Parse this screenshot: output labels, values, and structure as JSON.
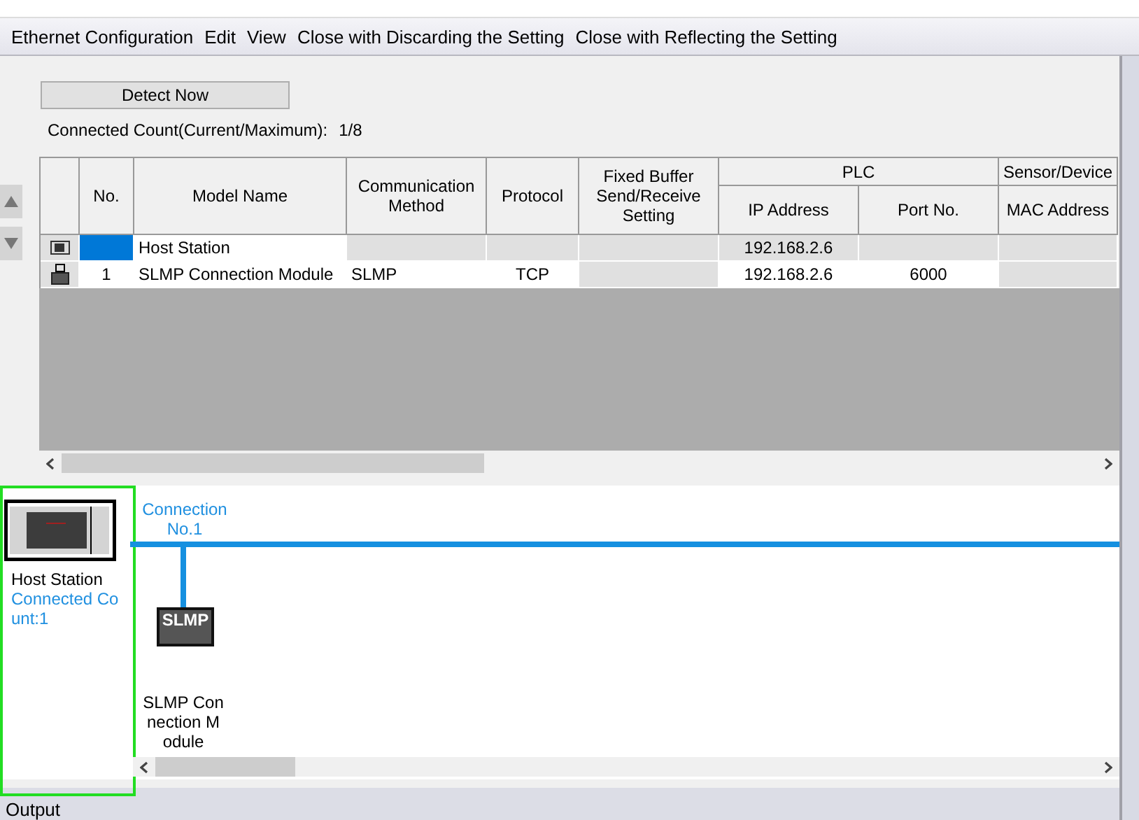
{
  "menu": [
    {
      "label": "Ethernet Configuration"
    },
    {
      "label": "Edit"
    },
    {
      "label": "View"
    },
    {
      "label": "Close with Discarding the Setting"
    },
    {
      "label": "Close with Reflecting the Setting"
    }
  ],
  "detect_button": "Detect Now",
  "connected_count": {
    "label": "Connected Count(Current/Maximum):",
    "value": "1/8"
  },
  "table": {
    "columns": [
      "No.",
      "Model Name",
      "Communication Method",
      "Protocol",
      "Fixed Buffer Send/Receive Setting"
    ],
    "groups": [
      {
        "label": "PLC",
        "columns": [
          "IP Address",
          "Port No."
        ]
      },
      {
        "label": "Sensor/Device",
        "columns": [
          "MAC Address"
        ]
      }
    ],
    "rows": [
      {
        "kind": "host",
        "selected": true,
        "cells": [
          "",
          "Host Station",
          "",
          "",
          "",
          "192.168.2.6",
          "",
          ""
        ]
      },
      {
        "kind": "module",
        "selected": false,
        "cells": [
          "1",
          "SLMP Connection Module",
          "SLMP",
          "TCP",
          "",
          "192.168.2.6",
          "6000",
          ""
        ]
      }
    ]
  },
  "diagram": {
    "connection_label": "Connection No.1",
    "host_label": "Host Station",
    "host_count": "Connected Count:1",
    "module_icon_text": "SLMP",
    "module_label": "SLMP Connection Module"
  },
  "output_tab": "Output"
}
